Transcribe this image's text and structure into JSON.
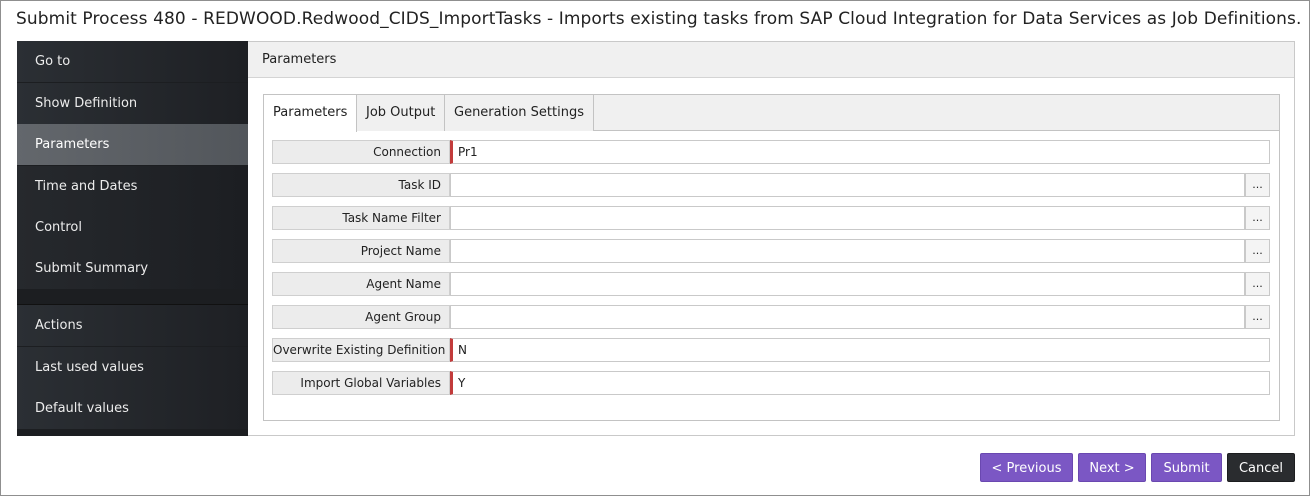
{
  "dialog": {
    "title": "Submit Process 480 - REDWOOD.Redwood_CIDS_ImportTasks - Imports existing tasks from SAP Cloud Integration for Data Services as Job Definitions."
  },
  "sidebar": {
    "items": [
      {
        "label": "Go to"
      },
      {
        "label": "Show Definition"
      },
      {
        "label": "Parameters",
        "active": true
      },
      {
        "label": "Time and Dates"
      },
      {
        "label": "Control"
      },
      {
        "label": "Submit Summary"
      },
      {
        "label": "Actions"
      },
      {
        "label": "Last used values"
      },
      {
        "label": "Default values"
      }
    ]
  },
  "main": {
    "header": "Parameters",
    "tabs": [
      {
        "label": "Parameters",
        "active": true
      },
      {
        "label": "Job Output"
      },
      {
        "label": "Generation Settings"
      }
    ],
    "params": [
      {
        "label": "Connection",
        "value": "Pr1",
        "required": true,
        "browse": false
      },
      {
        "label": "Task ID",
        "value": "",
        "required": false,
        "browse": true,
        "browse_label": "..."
      },
      {
        "label": "Task Name Filter",
        "value": "",
        "required": false,
        "browse": true,
        "browse_label": "..."
      },
      {
        "label": "Project Name",
        "value": "",
        "required": false,
        "browse": true,
        "browse_label": "..."
      },
      {
        "label": "Agent Name",
        "value": "",
        "required": false,
        "browse": true,
        "browse_label": "..."
      },
      {
        "label": "Agent Group",
        "value": "",
        "required": false,
        "browse": true,
        "browse_label": "..."
      },
      {
        "label": "Overwrite Existing Definition",
        "value": "N",
        "required": true,
        "browse": false
      },
      {
        "label": "Import Global Variables",
        "value": "Y",
        "required": true,
        "browse": false
      }
    ]
  },
  "footer": {
    "previous_label": "< Previous",
    "next_label": "Next >",
    "submit_label": "Submit",
    "cancel_label": "Cancel"
  },
  "colors": {
    "accent": "#7b57c4",
    "required_marker": "#c23b3b",
    "sidebar_bg": "#1c1e21",
    "sidebar_active": "#5a5e63",
    "cancel_bg": "#2a2c2f"
  }
}
